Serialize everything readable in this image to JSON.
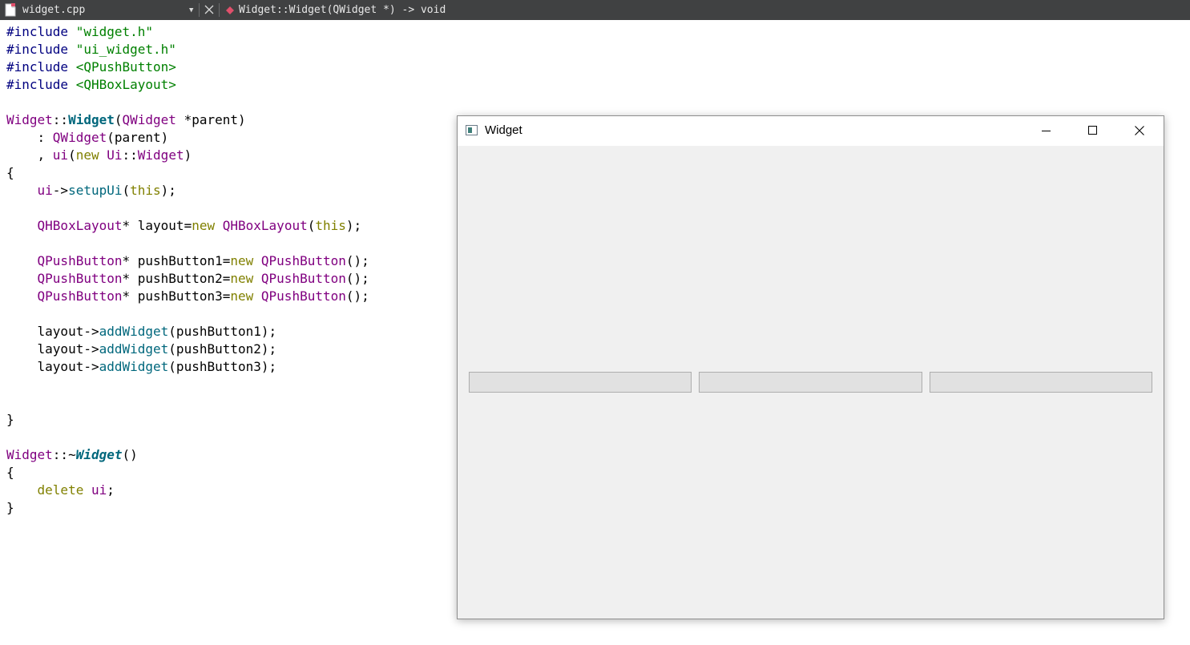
{
  "toolbar": {
    "filename": "widget.cpp",
    "file_icon": "document-icon",
    "dropdown_icon": "dropdown-arrow-icon",
    "close_icon": "close-icon",
    "symbol_icon": "function-diamond-icon",
    "symbol_signature": "Widget::Widget(QWidget *) -> void"
  },
  "colors": {
    "toolbar_bg": "#404142",
    "preprocessor": "#000080",
    "string": "#008000",
    "class": "#800080",
    "keyword": "#808000",
    "function": "#00677c",
    "symbol_icon": "#e0506b"
  },
  "code": {
    "lines": [
      [
        {
          "t": "#include ",
          "c": "pp"
        },
        {
          "t": "\"widget.h\"",
          "c": "str"
        }
      ],
      [
        {
          "t": "#include ",
          "c": "pp"
        },
        {
          "t": "\"ui_widget.h\"",
          "c": "str"
        }
      ],
      [
        {
          "t": "#include ",
          "c": "pp"
        },
        {
          "t": "<QPushButton>",
          "c": "str"
        }
      ],
      [
        {
          "t": "#include ",
          "c": "pp"
        },
        {
          "t": "<QHBoxLayout>",
          "c": "str"
        }
      ],
      [],
      [
        {
          "t": "Widget",
          "c": "cls"
        },
        {
          "t": "::",
          "c": "pl"
        },
        {
          "t": "Widget",
          "c": "fnb"
        },
        {
          "t": "(",
          "c": "pl"
        },
        {
          "t": "QWidget",
          "c": "cls"
        },
        {
          "t": " *parent)",
          "c": "pl"
        }
      ],
      [
        {
          "t": "    : ",
          "c": "pl"
        },
        {
          "t": "QWidget",
          "c": "cls"
        },
        {
          "t": "(parent)",
          "c": "pl"
        }
      ],
      [
        {
          "t": "    , ",
          "c": "pl"
        },
        {
          "t": "ui",
          "c": "cls"
        },
        {
          "t": "(",
          "c": "pl"
        },
        {
          "t": "new",
          "c": "kw"
        },
        {
          "t": " ",
          "c": "pl"
        },
        {
          "t": "Ui",
          "c": "cls"
        },
        {
          "t": "::",
          "c": "pl"
        },
        {
          "t": "Widget",
          "c": "cls"
        },
        {
          "t": ")",
          "c": "pl"
        }
      ],
      [
        {
          "t": "{",
          "c": "pl"
        }
      ],
      [
        {
          "t": "    ",
          "c": "pl"
        },
        {
          "t": "ui",
          "c": "cls"
        },
        {
          "t": "->",
          "c": "pl"
        },
        {
          "t": "setupUi",
          "c": "fn"
        },
        {
          "t": "(",
          "c": "pl"
        },
        {
          "t": "this",
          "c": "kw"
        },
        {
          "t": ");",
          "c": "pl"
        }
      ],
      [],
      [
        {
          "t": "    ",
          "c": "pl"
        },
        {
          "t": "QHBoxLayout",
          "c": "cls"
        },
        {
          "t": "* layout=",
          "c": "pl"
        },
        {
          "t": "new",
          "c": "kw"
        },
        {
          "t": " ",
          "c": "pl"
        },
        {
          "t": "QHBoxLayout",
          "c": "cls"
        },
        {
          "t": "(",
          "c": "pl"
        },
        {
          "t": "this",
          "c": "kw"
        },
        {
          "t": ");",
          "c": "pl"
        }
      ],
      [],
      [
        {
          "t": "    ",
          "c": "pl"
        },
        {
          "t": "QPushButton",
          "c": "cls"
        },
        {
          "t": "* pushButton1=",
          "c": "pl"
        },
        {
          "t": "new",
          "c": "kw"
        },
        {
          "t": " ",
          "c": "pl"
        },
        {
          "t": "QPushButton",
          "c": "cls"
        },
        {
          "t": "();",
          "c": "pl"
        }
      ],
      [
        {
          "t": "    ",
          "c": "pl"
        },
        {
          "t": "QPushButton",
          "c": "cls"
        },
        {
          "t": "* pushButton2=",
          "c": "pl"
        },
        {
          "t": "new",
          "c": "kw"
        },
        {
          "t": " ",
          "c": "pl"
        },
        {
          "t": "QPushButton",
          "c": "cls"
        },
        {
          "t": "();",
          "c": "pl"
        }
      ],
      [
        {
          "t": "    ",
          "c": "pl"
        },
        {
          "t": "QPushButton",
          "c": "cls"
        },
        {
          "t": "* pushButton3=",
          "c": "pl"
        },
        {
          "t": "new",
          "c": "kw"
        },
        {
          "t": " ",
          "c": "pl"
        },
        {
          "t": "QPushButton",
          "c": "cls"
        },
        {
          "t": "();",
          "c": "pl"
        }
      ],
      [],
      [
        {
          "t": "    layout->",
          "c": "pl"
        },
        {
          "t": "addWidget",
          "c": "fn"
        },
        {
          "t": "(pushButton1);",
          "c": "pl"
        }
      ],
      [
        {
          "t": "    layout->",
          "c": "pl"
        },
        {
          "t": "addWidget",
          "c": "fn"
        },
        {
          "t": "(pushButton2);",
          "c": "pl"
        }
      ],
      [
        {
          "t": "    layout->",
          "c": "pl"
        },
        {
          "t": "addWidget",
          "c": "fn"
        },
        {
          "t": "(pushButton3);",
          "c": "pl"
        }
      ],
      [],
      [],
      [
        {
          "t": "}",
          "c": "pl"
        }
      ],
      [],
      [
        {
          "t": "Widget",
          "c": "cls"
        },
        {
          "t": "::~",
          "c": "pl"
        },
        {
          "t": "Widget",
          "c": "fnbi"
        },
        {
          "t": "()",
          "c": "pl"
        }
      ],
      [
        {
          "t": "{",
          "c": "pl"
        }
      ],
      [
        {
          "t": "    ",
          "c": "pl"
        },
        {
          "t": "delete",
          "c": "kw"
        },
        {
          "t": " ",
          "c": "pl"
        },
        {
          "t": "ui",
          "c": "cls"
        },
        {
          "t": ";",
          "c": "pl"
        }
      ],
      [
        {
          "t": "}",
          "c": "pl"
        }
      ]
    ]
  },
  "window": {
    "title": "Widget",
    "app_icon": "qt-window-icon",
    "minimize_icon": "minimize-icon",
    "maximize_icon": "maximize-icon",
    "close_icon": "close-icon",
    "buttons": [
      {
        "label": ""
      },
      {
        "label": ""
      },
      {
        "label": ""
      }
    ]
  }
}
